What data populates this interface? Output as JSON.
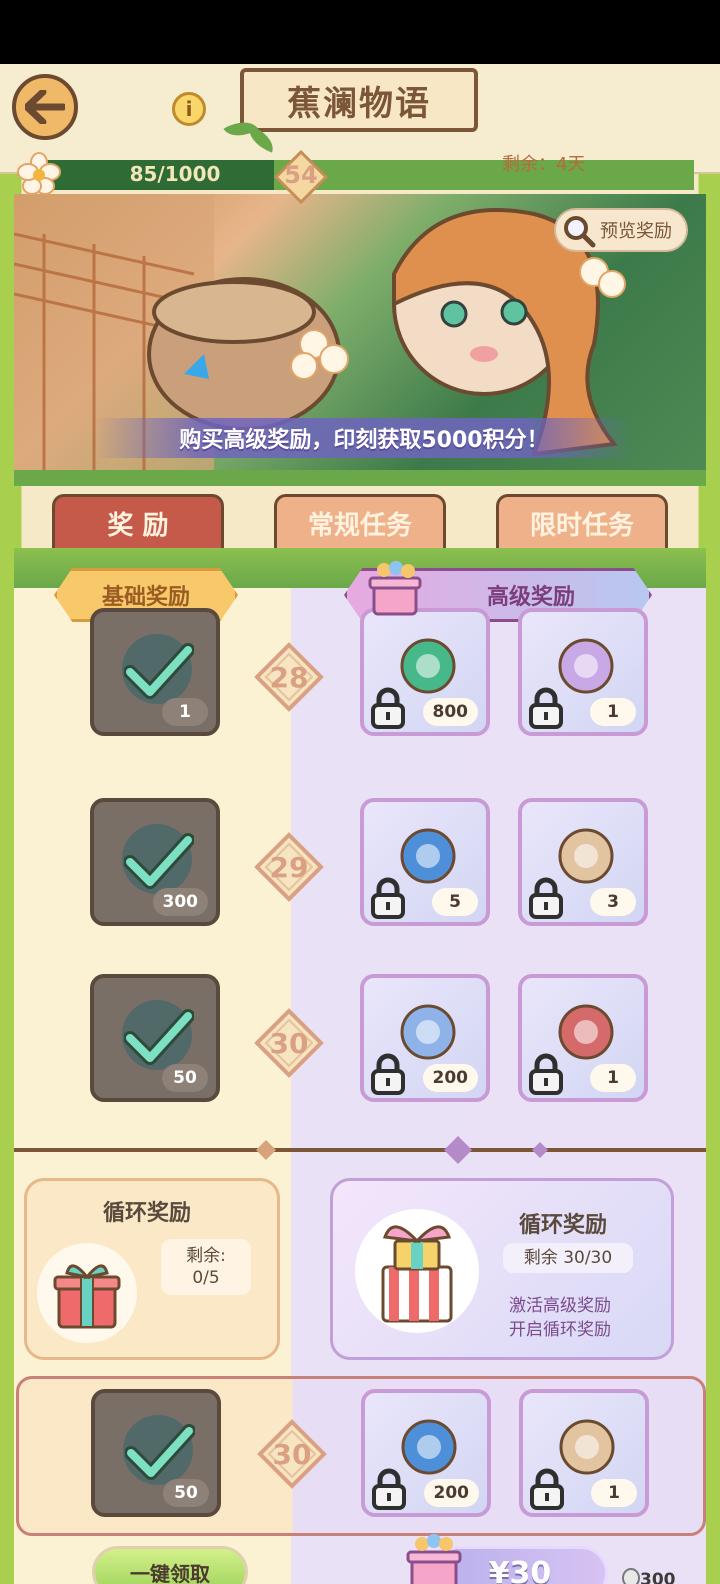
{
  "header": {
    "title": "蕉澜物语",
    "back_icon": "arrow-left-icon",
    "info_icon": "info-icon"
  },
  "progress": {
    "current": 85,
    "max": 1000,
    "text": "85/1000",
    "level": "54",
    "remaining_label": "剩余：4天"
  },
  "banner": {
    "preview_label": "预览奖励",
    "promo": "购买高级奖励，印刻获取5000积分！"
  },
  "tabs": [
    {
      "label": "奖 励",
      "active": true
    },
    {
      "label": "常规任务",
      "active": false
    },
    {
      "label": "限时任务",
      "active": false
    }
  ],
  "reward_headers": {
    "basic": "基础奖励",
    "advanced": "高级奖励"
  },
  "rows": [
    {
      "level": "28",
      "basic": {
        "count": "1",
        "claimed": true
      },
      "adv1": {
        "count": "800",
        "locked": true
      },
      "adv2": {
        "count": "1",
        "locked": true
      }
    },
    {
      "level": "29",
      "basic": {
        "count": "300",
        "claimed": true
      },
      "adv1": {
        "count": "5",
        "locked": true
      },
      "adv2": {
        "count": "3",
        "locked": true
      }
    },
    {
      "level": "30",
      "basic": {
        "count": "50",
        "claimed": true
      },
      "adv1": {
        "count": "200",
        "locked": true
      },
      "adv2": {
        "count": "1",
        "locked": true
      }
    }
  ],
  "cycle": {
    "basic": {
      "title": "循环奖励",
      "remain_label": "剩余:",
      "remain_value": "0/5"
    },
    "advanced": {
      "title": "循环奖励",
      "remain": "剩余 30/30",
      "desc_line1": "激活高级奖励",
      "desc_line2": "开启循环奖励"
    }
  },
  "sticky": {
    "level": "30",
    "basic_count": "50",
    "adv1_count": "200",
    "adv2_count": "1"
  },
  "bottom": {
    "claim_all": "一键领取",
    "price": "¥30",
    "coin_count": "300"
  },
  "colors": {
    "primary_tab": "#c55a4a",
    "green": "#6aa84a",
    "brown": "#7b5637"
  }
}
